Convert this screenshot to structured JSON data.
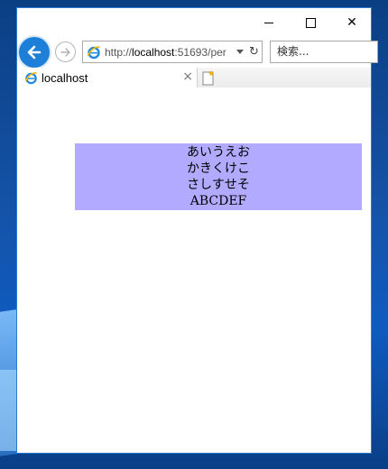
{
  "window": {
    "close_glyph": "✕"
  },
  "navbar": {
    "address_protocol": "http://",
    "address_host": "localhost",
    "address_rest": ":51693/per",
    "refresh_glyph": "↻",
    "search_placeholder": "検索..."
  },
  "tab": {
    "label": "localhost",
    "close_glyph": "×"
  },
  "content": {
    "lines": [
      "あいうえお",
      "かきくけこ",
      "さしすせそ",
      "ABCDEF"
    ]
  },
  "colors": {
    "accent": "#1e7fd8",
    "box_background": "#b2aaff"
  }
}
